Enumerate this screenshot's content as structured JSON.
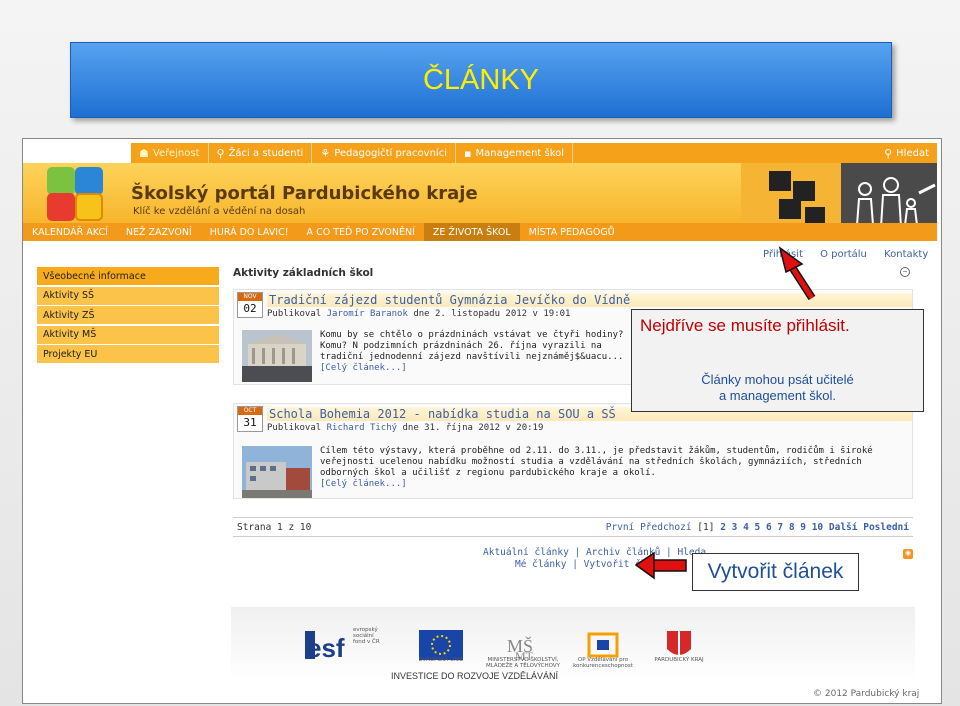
{
  "slide": {
    "title": "ČLÁNKY"
  },
  "topnav": {
    "items": [
      "Veřejnost",
      "Žáci a studenti",
      "Pedagogičtí pracovníci",
      "Management škol"
    ],
    "search": "Hledat"
  },
  "header": {
    "title": "Školský portál Pardubického kraje",
    "subtitle": "Klíč ke vzdělání a vědění na dosah"
  },
  "subnav": {
    "items": [
      "KALENDÁŘ AKCÍ",
      "NEŽ ZAZVONÍ",
      "HURÁ DO LAVIC!",
      "A CO TEĎ PO ZVONĚNÍ",
      "ZE ŽIVOTA ŠKOL",
      "MÍSTA PEDAGOGŮ"
    ]
  },
  "sidebar": {
    "items": [
      "Všeobecné informace",
      "Aktivity SŠ",
      "Aktivity ZŠ",
      "Aktivity MŠ",
      "Projekty EU"
    ]
  },
  "toplinks": {
    "login": "Přihlásit",
    "about": "O portálu",
    "contacts": "Kontakty"
  },
  "section_title": "Aktivity základních škol",
  "articles": [
    {
      "month": "NOV",
      "day": "02",
      "title": "Tradiční zájezd studentů Gymnázia Jevíčko do Vídně",
      "meta_prefix": "Publikoval",
      "author": "Jaromír Baranok",
      "meta_suffix": "dne 2. listopadu 2012 v 19:01",
      "text": "Komu by se chtělo o prázdninách vstávat ve čtyři hodiny? Komu? N podzimních prázdninách 26. října vyrazili na tradiční jednodenní zájezd navštívili nejznáměj$&uacu...",
      "more": "[Celý článek...]"
    },
    {
      "month": "OCT",
      "day": "31",
      "title": "Schola Bohemia 2012 - nabídka studia na SOU a SŠ",
      "meta_prefix": "Publikoval",
      "author": "Richard Tichý",
      "meta_suffix": "dne 31. října 2012 v 20:19",
      "text": "Cílem této výstavy, která proběhne od 2.11. do 3.11., je představit žákům, studentům, rodičům i široké veřejnosti ucelenou nabídku možností studia a vzdělávání na středních školách, gymnáziích, středních odborných škol a učilišť z regionu pardubického kraje a okolí.",
      "more": "[Celý článek...]"
    }
  ],
  "pager": {
    "info": "Strana 1 z 10",
    "first": "První",
    "prev": "Předchozí",
    "current": "[1]",
    "pages": "2 3 4 5 6 7 8 9 10",
    "next": "Další",
    "last": "Poslední"
  },
  "footlinks": {
    "line1": "Aktuální články | Archiv článků | Hleda",
    "line2": "Mé články | Vytvořit článek"
  },
  "logos": {
    "esf_line1": "evropský",
    "esf_line2": "sociální",
    "esf_line3": "fond v ČR",
    "eu": "EVROPSKÁ UNIE",
    "msmt": "MINISTERSTVO ŠKOLSTVÍ, MLÁDEŽE A TĚLOVÝCHOVY",
    "op": "OP Vzdělávání pro konkurenceschopnost",
    "kraj": "PARDUBICKÝ KRAJ",
    "invest": "INVESTICE DO ROZVOJE VZDĚLÁVÁNÍ"
  },
  "copyright": "© 2012 Pardubický kraj",
  "callout": {
    "headline": "Nejdříve se musíte přihlásit.",
    "note_line1": "Články mohou psát učitelé",
    "note_line2": "a management škol."
  },
  "create_label": "Vytvořit článek",
  "colors": {
    "accent_orange": "#f39a1a",
    "link_blue": "#3b5fa8",
    "callout_red": "#c00000",
    "arrow_red": "#e01010"
  },
  "icons": [
    "people-icon",
    "search-icon",
    "rss-icon",
    "collapse-icon",
    "calendar-icon"
  ]
}
